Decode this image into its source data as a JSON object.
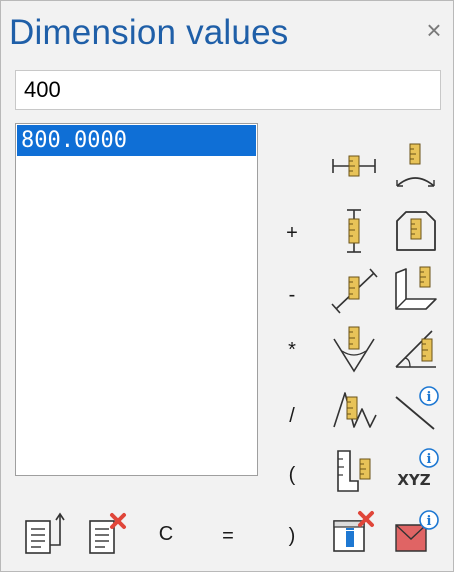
{
  "dialog": {
    "title": "Dimension values",
    "close_glyph": "×"
  },
  "input": {
    "value": "400"
  },
  "list": {
    "items": [
      "800.0000"
    ]
  },
  "operators": {
    "plus": "+",
    "minus": "-",
    "multiply": "*",
    "divide": "/",
    "open_paren": "(",
    "close_paren": ")",
    "clear": "C",
    "equals": "="
  },
  "icons": [
    "horizontal-dimension-icon",
    "arc-dimension-icon",
    "vertical-dimension-icon",
    "perimeter-dimension-icon",
    "aligned-dimension-icon",
    "perpendicular-dimension-icon",
    "angle-dimension-icon",
    "angle-measure-icon",
    "cumulative-dimension-icon",
    "line-info-icon",
    "height-level-icon",
    "xyz-info-icon",
    "paste-to-list-icon",
    "delete-list-icon",
    "clear-info-icon",
    "surface-info-icon"
  ],
  "colors": {
    "title": "#1f5fa8",
    "selection": "#0f6fd6",
    "ruler": "#e8c358",
    "info": "#1e78d2",
    "delete": "#e0463a"
  }
}
